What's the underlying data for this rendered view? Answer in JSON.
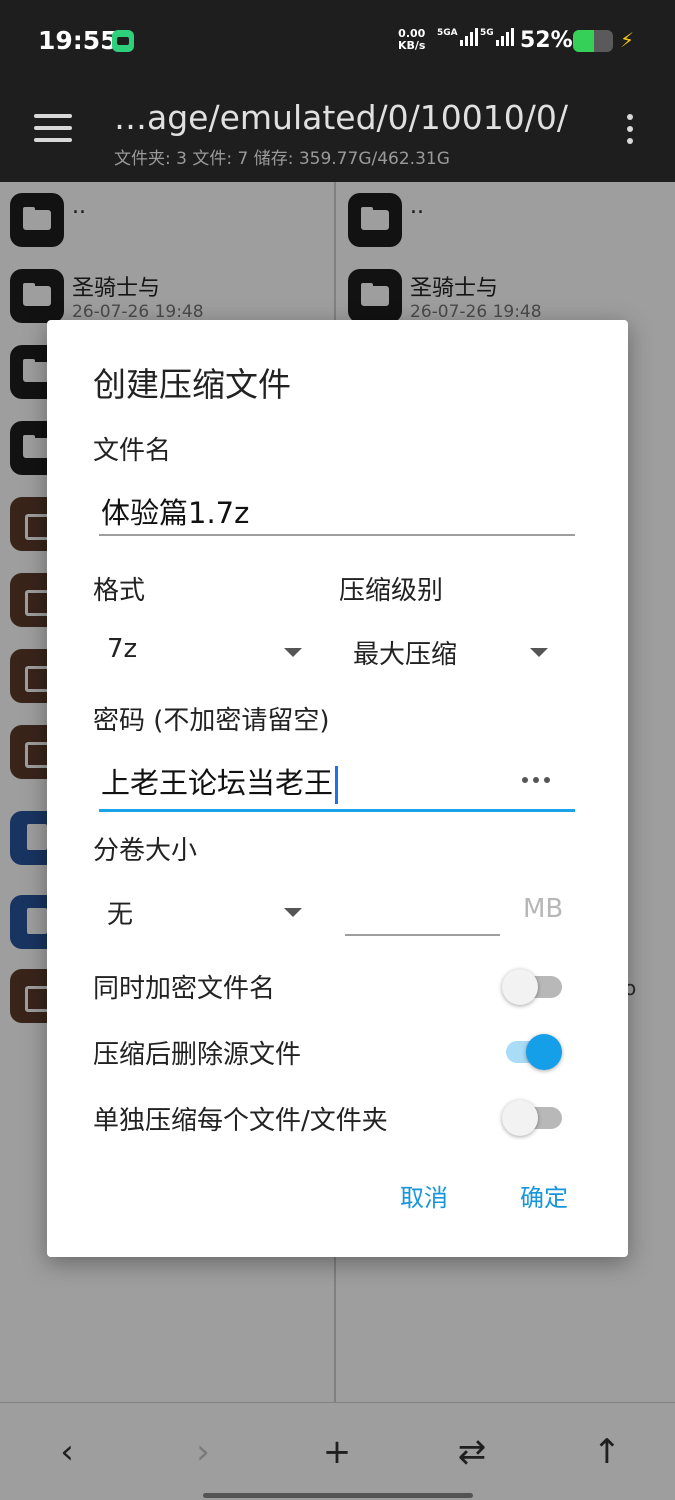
{
  "status_bar": {
    "time": "19:55",
    "net_speed_value": "0.00",
    "net_speed_unit": "KB/s",
    "sim1_label": "5GA",
    "sim2_label": "5G",
    "battery_percent": "52%",
    "battery_level": 0.52,
    "colors": {
      "background": "#1e1e1e",
      "battery_fill": "#34d058",
      "charging_bolt": "#f5c518",
      "app_badge": "#2fd07c"
    }
  },
  "toolbar": {
    "path": "…age/emulated/0/10010/0/",
    "summary": "文件夹: 3  文件: 7  储存: 359.77G/462.31G"
  },
  "left_pane": {
    "rows": [
      {
        "type": "folder",
        "name": "..",
        "date": ""
      },
      {
        "type": "folder",
        "name": "圣骑士与",
        "date": "26-07-26 19:48"
      }
    ]
  },
  "right_pane": {
    "rows": [
      {
        "type": "folder",
        "name": "..",
        "date": ""
      },
      {
        "type": "folder",
        "name": "圣骑士与",
        "date": "26-07-26 19:48"
      }
    ],
    "partial_text": "o"
  },
  "dialog": {
    "title": "创建压缩文件",
    "filename_label": "文件名",
    "filename_value": "体验篇1.7z",
    "format_label": "格式",
    "format_value": "7z",
    "level_label": "压缩级别",
    "level_value": "最大压缩",
    "password_label": "密码 (不加密请留空)",
    "password_value": "上老王论坛当老王",
    "volume_label": "分卷大小",
    "volume_value": "无",
    "volume_size_value": "",
    "volume_unit": "MB",
    "toggles": [
      {
        "label": "同时加密文件名",
        "on": false
      },
      {
        "label": "压缩后删除源文件",
        "on": true
      },
      {
        "label": "单独压缩每个文件/文件夹",
        "on": false
      }
    ],
    "cancel_label": "取消",
    "ok_label": "确定",
    "colors": {
      "accent": "#159fe8",
      "button_text": "#1796db"
    }
  },
  "bottom_nav": {
    "back_icon": "‹",
    "forward_icon": "›",
    "add_icon": "+",
    "swap_icon": "⇄",
    "up_icon": "↑"
  }
}
